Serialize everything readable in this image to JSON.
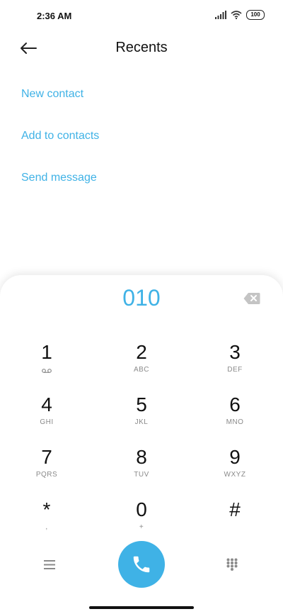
{
  "status_bar": {
    "time": "2:36 AM",
    "battery": "100"
  },
  "header": {
    "title": "Recents"
  },
  "options": [
    "New contact",
    "Add to contacts",
    "Send message"
  ],
  "dialer": {
    "number": "010",
    "keys": [
      {
        "digit": "1",
        "letters": ""
      },
      {
        "digit": "2",
        "letters": "ABC"
      },
      {
        "digit": "3",
        "letters": "DEF"
      },
      {
        "digit": "4",
        "letters": "GHI"
      },
      {
        "digit": "5",
        "letters": "JKL"
      },
      {
        "digit": "6",
        "letters": "MNO"
      },
      {
        "digit": "7",
        "letters": "PQRS"
      },
      {
        "digit": "8",
        "letters": "TUV"
      },
      {
        "digit": "9",
        "letters": "WXYZ"
      },
      {
        "digit": "*",
        "letters": ","
      },
      {
        "digit": "0",
        "letters": "+"
      },
      {
        "digit": "#",
        "letters": ""
      }
    ]
  },
  "colors": {
    "accent": "#3fb2e6"
  },
  "icons": [
    "back-arrow-icon",
    "signal-icon",
    "wifi-icon",
    "battery-icon",
    "backspace-icon",
    "voicemail-icon",
    "menu-icon",
    "call-icon",
    "keypad-icon"
  ]
}
